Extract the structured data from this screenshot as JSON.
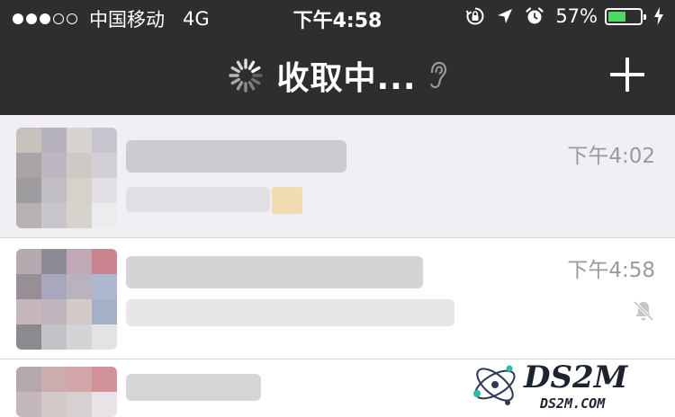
{
  "status_bar": {
    "signal_bars_filled": 3,
    "signal_bars_total": 5,
    "carrier": "中国移动",
    "network": "4G",
    "time": "下午4:58",
    "battery_percent": "57%",
    "battery_level": 0.57,
    "icons": [
      "rotation-lock-icon",
      "location-arrow-icon",
      "alarm-clock-icon",
      "charging-bolt-icon"
    ]
  },
  "nav": {
    "title": "收取中...",
    "icons": [
      "loading-spinner-icon",
      "earpiece-icon",
      "plus-icon"
    ]
  },
  "chats": [
    {
      "time": "下午4:02",
      "muted": false
    },
    {
      "time": "下午4:58",
      "muted": true
    },
    {
      "time": "",
      "muted": false
    }
  ],
  "watermark": {
    "brand": "DS2M",
    "site": "DS2M.COM"
  },
  "colors": {
    "header_bg": "#2e2e30",
    "pinned_row_bg": "#f1eff3",
    "time_text": "#9a9a9a",
    "battery_fill": "#4cd964"
  }
}
